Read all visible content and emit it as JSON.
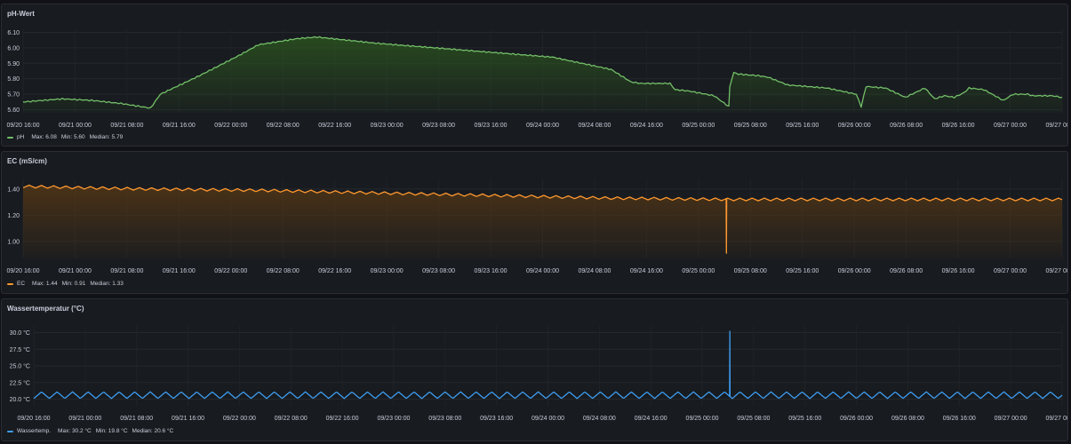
{
  "panels": [
    {
      "title": "pH-Wert",
      "legend": {
        "name": "pH",
        "max": "Max: 6.08",
        "min": "Min: 5.60",
        "median": "Median: 5.79"
      },
      "color": "#73bf69",
      "fill": "#2d5a1f"
    },
    {
      "title": "EC (mS/cm)",
      "legend": {
        "name": "EC",
        "max": "Max: 1.44",
        "min": "Min: 0.91",
        "median": "Median: 1.33"
      },
      "color": "#ff9830",
      "fill": "#5a3a14"
    },
    {
      "title": "Wassertemperatur (°C)",
      "legend": {
        "name": "Wassertemp.",
        "max": "Max: 30.2 °C",
        "min": "Min: 19.8 °C",
        "median": "Median: 20.6 °C"
      },
      "color": "#3d9df2",
      "fill": ""
    }
  ],
  "x_ticks": [
    "09/20 16:00",
    "09/21 00:00",
    "09/21 08:00",
    "09/21 16:00",
    "09/22 00:00",
    "09/22 08:00",
    "09/22 16:00",
    "09/23 00:00",
    "09/23 08:00",
    "09/23 16:00",
    "09/24 00:00",
    "09/24 08:00",
    "09/24 16:00",
    "09/25 00:00",
    "09/25 08:00",
    "09/25 16:00",
    "09/26 00:00",
    "09/26 08:00",
    "09/26 16:00",
    "09/27 00:00",
    "09/27 08:00"
  ],
  "chart_data": [
    {
      "type": "line",
      "title": "pH-Wert",
      "series": [
        {
          "name": "pH",
          "x_hours": [
            0,
            8,
            14,
            20,
            24,
            26,
            28,
            36,
            44,
            48,
            56,
            60,
            72,
            84,
            96,
            108,
            120,
            124,
            126,
            132,
            133,
            136,
            141,
            144,
            144.2,
            145,
            146,
            150,
            152,
            156,
            160,
            164,
            170,
            171,
            172,
            176,
            180,
            184,
            186,
            188,
            190,
            192,
            193,
            196,
            200,
            202,
            205,
            206,
            210,
            212
          ],
          "values": [
            5.65,
            5.67,
            5.66,
            5.64,
            5.62,
            5.61,
            5.7,
            5.82,
            5.95,
            6.02,
            6.06,
            6.07,
            6.03,
            6.0,
            5.97,
            5.94,
            5.86,
            5.78,
            5.77,
            5.77,
            5.73,
            5.72,
            5.69,
            5.62,
            5.75,
            5.84,
            5.83,
            5.82,
            5.81,
            5.76,
            5.75,
            5.74,
            5.7,
            5.62,
            5.75,
            5.74,
            5.68,
            5.74,
            5.67,
            5.69,
            5.68,
            5.71,
            5.74,
            5.73,
            5.66,
            5.7,
            5.7,
            5.69,
            5.69,
            5.68
          ]
        }
      ],
      "ylim": [
        5.58,
        6.12
      ],
      "y_ticks": [
        5.6,
        5.7,
        5.8,
        5.9,
        6.0,
        6.1
      ],
      "y_tick_labels": [
        "5.60",
        "5.70",
        "5.80",
        "5.90",
        "6.00",
        "6.10"
      ]
    },
    {
      "type": "line",
      "title": "EC (mS/cm)",
      "series": [
        {
          "name": "EC",
          "base": [
            [
              0,
              1.42
            ],
            [
              24,
              1.4
            ],
            [
              48,
              1.39
            ],
            [
              72,
              1.37
            ],
            [
              96,
              1.35
            ],
            [
              120,
              1.33
            ],
            [
              144,
              1.32
            ],
            [
              168,
              1.32
            ],
            [
              212,
              1.32
            ]
          ],
          "amplitude": 0.01,
          "period_hours": 2.5,
          "spikes": [
            {
              "x_hours": 143.5,
              "value": 0.91
            }
          ]
        }
      ],
      "ylim": [
        0.87,
        1.48
      ],
      "y_ticks": [
        1.0,
        1.2,
        1.4
      ],
      "y_tick_labels": [
        "1.00",
        "1.20",
        "1.40"
      ]
    },
    {
      "type": "line",
      "title": "Wassertemperatur (°C)",
      "series": [
        {
          "name": "Wassertemp.",
          "base": [
            [
              0,
              20.6
            ],
            [
              212,
              20.6
            ]
          ],
          "amplitude": 0.5,
          "period_hours": 3.2,
          "spikes": [
            {
              "x_hours": 143.5,
              "value": 30.2
            }
          ]
        }
      ],
      "ylim": [
        19.0,
        31.0
      ],
      "y_ticks": [
        20.0,
        22.5,
        25.0,
        27.5,
        30.0
      ],
      "y_tick_labels": [
        "20.0 °C",
        "22.5 °C",
        "25.0 °C",
        "27.5 °C",
        "30.0 °C"
      ]
    }
  ]
}
